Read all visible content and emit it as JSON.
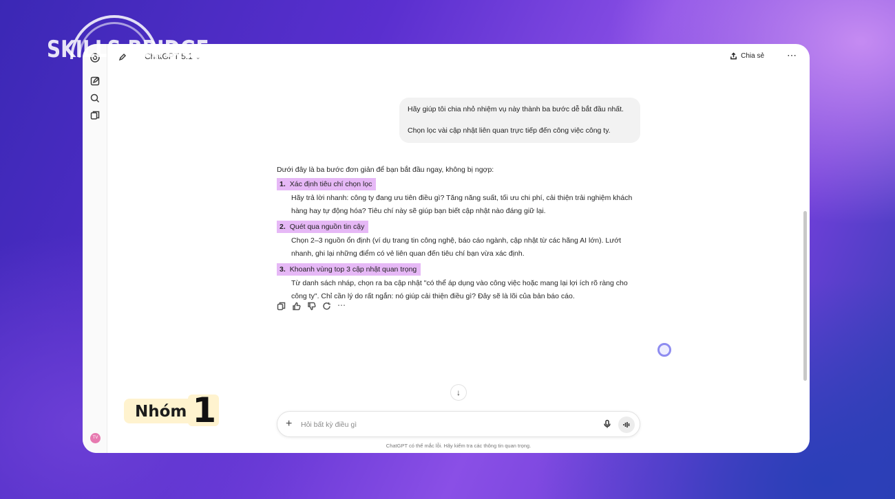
{
  "brand": {
    "text": "SKILLS BRIDGE"
  },
  "topbar": {
    "model_name": "ChatGPT 5.1",
    "share_label": "Chia sẻ",
    "more_label": "⋯"
  },
  "user_message": {
    "line1": "Hãy giúp tôi chia nhỏ nhiệm vụ này thành ba bước dễ bắt đầu nhất.",
    "line2": "Chọn lọc vài cập nhật liên quan trực tiếp đến công việc công ty."
  },
  "answer": {
    "intro": "Dưới đây là ba bước đơn giản để bạn bắt đầu ngay, không bị ngợp:",
    "steps": [
      {
        "number": "1.",
        "title": "Xác định tiêu chí chọn lọc",
        "body": "Hãy trả lời nhanh: công ty đang ưu tiên điều gì? Tăng năng suất, tối ưu chi phí, cải thiện trải nghiệm khách hàng hay tự động hóa? Tiêu chí này sẽ giúp bạn biết cập nhật nào đáng giữ lại."
      },
      {
        "number": "2.",
        "title": "Quét qua nguồn tin cậy",
        "body": "Chọn 2–3 nguồn ổn định (ví dụ trang tin công nghệ, báo cáo ngành, cập nhật từ các hãng AI lớn). Lướt nhanh, ghi lại những điểm có vẻ liên quan đến tiêu chí bạn vừa xác định."
      },
      {
        "number": "3.",
        "title": "Khoanh vùng top 3 cập nhật quan trọng",
        "body": "Từ danh sách nháp, chọn ra ba cập nhật \"có thể áp dụng vào công việc hoặc mang lại lợi ích rõ ràng cho công ty\". Chỉ cần lý do rất ngắn: nó giúp cải thiện điều gì? Đây sẽ là lõi của bản báo cáo."
      }
    ]
  },
  "composer": {
    "placeholder": "Hỏi bất kỳ điều gì"
  },
  "disclaimer": "ChatGPT có thể mắc lỗi. Hãy kiểm tra các thông tin quan trọng.",
  "avatar_initials": "TV",
  "overlay_badge": {
    "label": "Nhóm",
    "number": "1"
  },
  "colors": {
    "highlight": "#e6b8f6",
    "badge_bg": "#fff3cf",
    "avatar": "#e77ab0"
  },
  "icons": [
    "new-chat-icon",
    "search-icon",
    "library-icon",
    "edit-icon",
    "share-icon",
    "copy-icon",
    "thumbs-up-icon",
    "thumbs-down-icon",
    "regenerate-icon",
    "arrow-down-icon",
    "plus-icon",
    "mic-icon",
    "voice-icon"
  ]
}
